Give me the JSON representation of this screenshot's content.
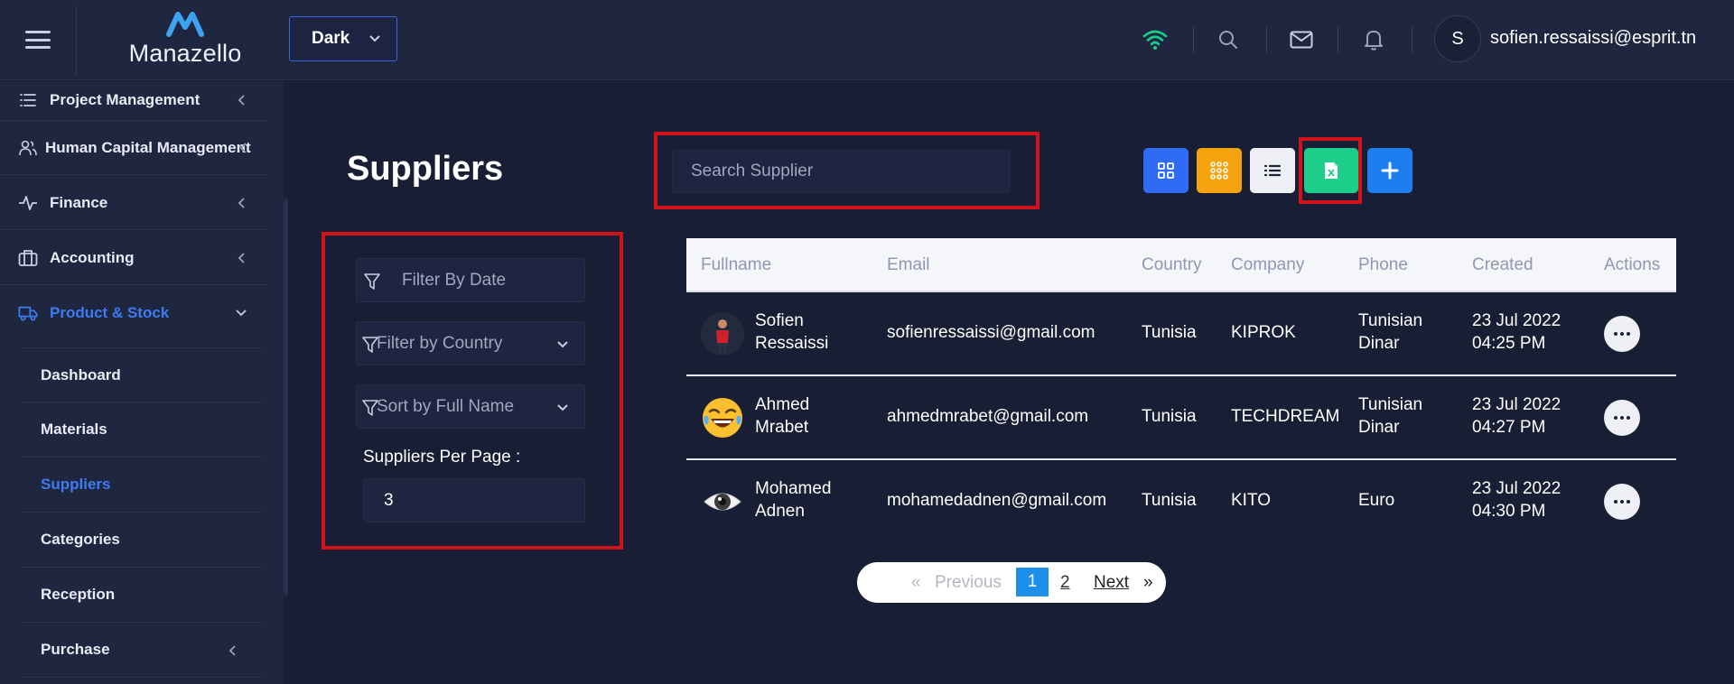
{
  "header": {
    "app_name": "Manazello",
    "theme_value": "Dark",
    "user_initial": "S",
    "user_email": "sofien.ressaissi@esprit.tn"
  },
  "sidebar": {
    "items": [
      {
        "label": "Project Management",
        "icon": "list-icon"
      },
      {
        "label": "Human Capital Management",
        "icon": "users-icon"
      },
      {
        "label": "Finance",
        "icon": "activity-icon"
      },
      {
        "label": "Accounting",
        "icon": "briefcase-icon"
      },
      {
        "label": "Product & Stock",
        "icon": "truck-icon"
      }
    ],
    "sub_items": [
      "Dashboard",
      "Materials",
      "Suppliers",
      "Categories",
      "Reception",
      "Purchase"
    ]
  },
  "page": {
    "title": "Suppliers",
    "search_placeholder": "Search Supplier"
  },
  "filters": {
    "date_placeholder": "Filter By Date",
    "country_label": "Filter by Country",
    "sort_label": "Sort by Full Name",
    "per_page_label": "Suppliers Per Page :",
    "per_page_value": "3"
  },
  "table": {
    "headers": [
      "Fullname",
      "Email",
      "Country",
      "Company",
      "Phone",
      "Created",
      "Actions"
    ],
    "rows": [
      {
        "first": "Sofien",
        "last": "Ressaissi",
        "email": "sofienressaissi@gmail.com",
        "country": "Tunisia",
        "company": "KIPROK",
        "phone_1": "Tunisian",
        "phone_2": "Dinar",
        "created_date": "23 Jul 2022",
        "created_time": "04:25 PM",
        "avatar": "person-photo"
      },
      {
        "first": "Ahmed",
        "last": "Mrabet",
        "email": "ahmedmrabet@gmail.com",
        "country": "Tunisia",
        "company": "TECHDREAM",
        "phone_1": "Tunisian",
        "phone_2": "Dinar",
        "created_date": "23 Jul 2022",
        "created_time": "04:27 PM",
        "avatar": "laughing-emoji"
      },
      {
        "first": "Mohamed",
        "last": "Adnen",
        "email": "mohamedadnen@gmail.com",
        "country": "Tunisia",
        "company": "KITO",
        "phone_1": "Euro",
        "phone_2": "",
        "created_date": "23 Jul 2022",
        "created_time": "04:30 PM",
        "avatar": "eye-emoji"
      }
    ]
  },
  "pagination": {
    "laquo": "«",
    "previous": "Previous",
    "current": "1",
    "page2": "2",
    "next": "Next",
    "raquo": "»"
  },
  "colors": {
    "background": "#181e34",
    "panel": "#1f2640",
    "accent_blue": "#3d7bf0",
    "highlight_red": "#d0121b",
    "grid_button": "#2f6bf5",
    "apps_button": "#f5a30d",
    "list_button": "#eef0f6",
    "excel_button": "#1dce8b",
    "add_button": "#1e7ef0"
  }
}
